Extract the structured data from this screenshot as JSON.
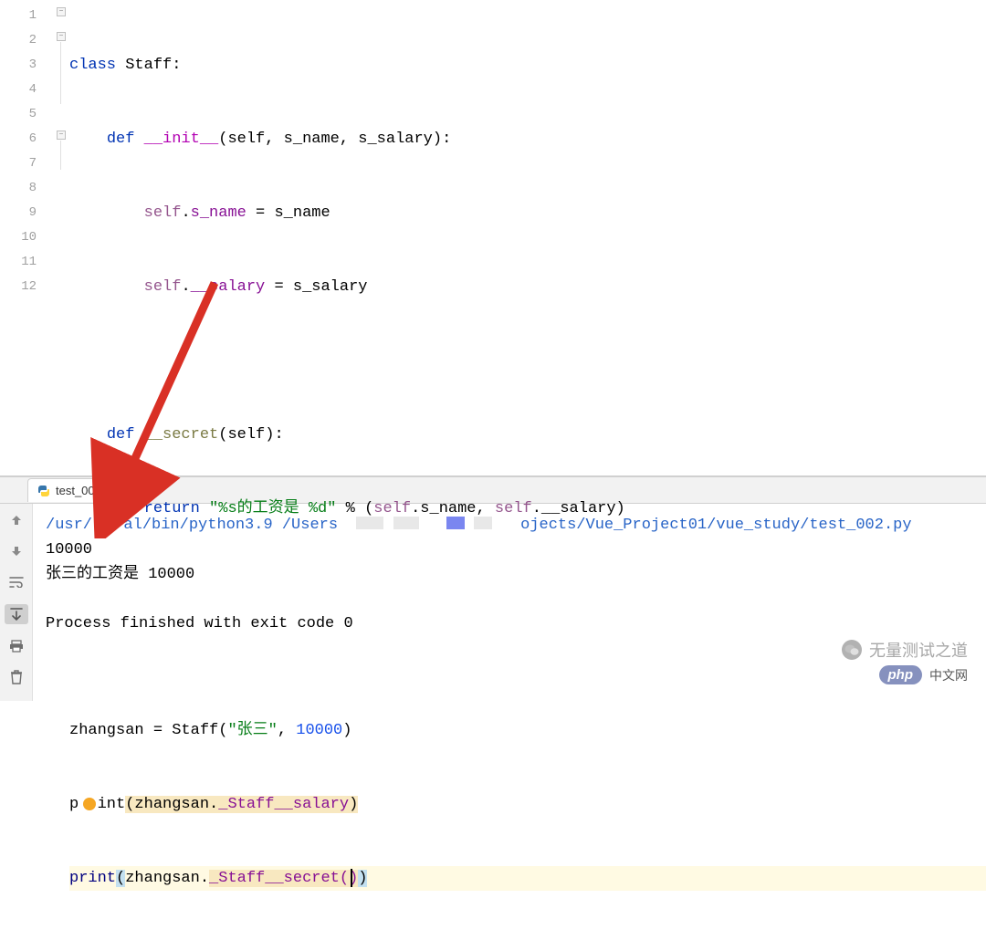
{
  "editor": {
    "line_numbers": [
      "1",
      "2",
      "3",
      "4",
      "5",
      "6",
      "7",
      "8",
      "9",
      "10",
      "11",
      "12"
    ],
    "code": {
      "l1": {
        "kw_class": "class",
        "cls": "Staff",
        "colon": ":"
      },
      "l2": {
        "kw_def": "def",
        "fn": "__init__",
        "params": "(self, s_name, s_salary):"
      },
      "l3": {
        "self": "self",
        "dot": ".",
        "attr": "s_name",
        "eq": " = s_name"
      },
      "l4": {
        "self": "self",
        "dot": ".",
        "attr": "__salary",
        "eq": " = s_salary"
      },
      "l6": {
        "kw_def": "def",
        "fn": "__secret",
        "params": "(self):"
      },
      "l7": {
        "kw_return": "return",
        "str": "\"%s的工资是 %d\"",
        "pct": " % (",
        "self1": "self",
        "dot1": ".s_name, ",
        "self2": "self",
        "dot2": ".__salary)"
      },
      "l10": {
        "var": "zhangsan = Staff(",
        "str": "\"张三\"",
        "comma": ", ",
        "num": "10000",
        "close": ")"
      },
      "l11": {
        "pre": "p",
        "mid": "int",
        "open": "(",
        "arg": "zhangsan.",
        "hl": "_Staff__salary",
        "close": ")"
      },
      "l12": {
        "fn": "print",
        "open": "(",
        "arg": "zhangsan.",
        "hl": "_Staff__secret()",
        "close": ")"
      }
    }
  },
  "tab": {
    "label": "test_002",
    "close": "×"
  },
  "console": {
    "path_prefix": "/usr/lo",
    "path_mid": "al/bin/python3.9 /Users",
    "path_suffix": "ojects/Vue_Project01/vue_study/test_002.py",
    "out1": "10000",
    "out2": "张三的工资是 10000",
    "exit": "Process finished with exit code 0"
  },
  "watermark": {
    "text1": "无量测试之道",
    "badge": "php",
    "cn": "中文网"
  }
}
